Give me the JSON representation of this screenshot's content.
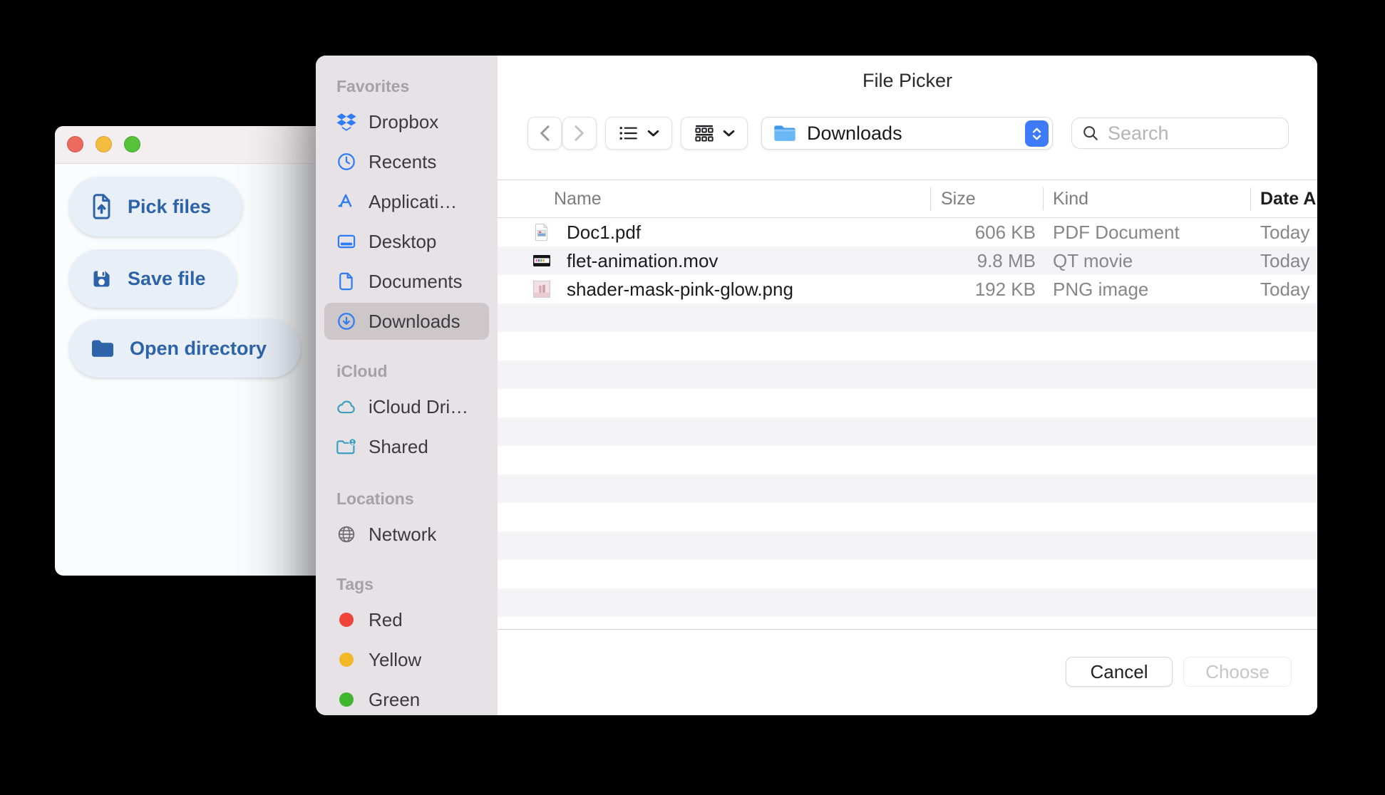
{
  "app_window": {
    "traffic_lights": [
      {
        "id": "close",
        "color": "#ed6a5e",
        "border": "#d65548"
      },
      {
        "id": "minimize",
        "color": "#f4bd3e",
        "border": "#d9a132"
      },
      {
        "id": "zoom",
        "color": "#57c33b",
        "border": "#47a52f"
      }
    ],
    "buttons": [
      {
        "id": "pick-files",
        "label": "Pick files",
        "icon": "document-upload-icon"
      },
      {
        "id": "save-file",
        "label": "Save file",
        "icon": "save-icon"
      },
      {
        "id": "open-directory",
        "label": "Open directory",
        "icon": "folder-icon"
      }
    ]
  },
  "dialog": {
    "title": "File Picker",
    "sidebar": {
      "sections": [
        {
          "header": "Favorites",
          "items": [
            {
              "label": "Dropbox",
              "icon": "dropbox-icon"
            },
            {
              "label": "Recents",
              "icon": "clock-icon"
            },
            {
              "label": "Applicati…",
              "icon": "appstore-icon"
            },
            {
              "label": "Desktop",
              "icon": "desktop-icon"
            },
            {
              "label": "Documents",
              "icon": "document-icon"
            },
            {
              "label": "Downloads",
              "icon": "download-circle-icon",
              "selected": true
            }
          ]
        },
        {
          "header": "iCloud",
          "items": [
            {
              "label": "iCloud Dri…",
              "icon": "cloud-icon"
            },
            {
              "label": "Shared",
              "icon": "shared-folder-icon"
            }
          ]
        },
        {
          "header": "Locations",
          "items": [
            {
              "label": "Network",
              "icon": "globe-icon"
            }
          ]
        },
        {
          "header": "Tags",
          "items": [
            {
              "label": "Red",
              "icon": "tag-dot-icon",
              "color": "#f0443a"
            },
            {
              "label": "Yellow",
              "icon": "tag-dot-icon",
              "color": "#f3b827"
            },
            {
              "label": "Green",
              "icon": "tag-dot-icon",
              "color": "#41b52e"
            }
          ]
        }
      ]
    },
    "toolbar": {
      "path_label": "Downloads",
      "search_placeholder": "Search"
    },
    "table": {
      "columns": [
        {
          "label": "Name",
          "sorted": false
        },
        {
          "label": "Size",
          "sorted": false
        },
        {
          "label": "Kind",
          "sorted": false
        },
        {
          "label": "Date Added",
          "sorted": true
        }
      ],
      "rows": [
        {
          "name": "Doc1.pdf",
          "icon": "pdf-file-icon",
          "size": "606 KB",
          "kind": "PDF Document",
          "date_added": "Today"
        },
        {
          "name": "flet-animation.mov",
          "icon": "mov-file-icon",
          "size": "9.8 MB",
          "kind": "QT movie",
          "date_added": "Today"
        },
        {
          "name": "shader-mask-pink-glow.png",
          "icon": "png-file-icon",
          "size": "192 KB",
          "kind": "PNG image",
          "date_added": "Today"
        }
      ],
      "empty_row_count": 12
    },
    "footer": {
      "cancel_label": "Cancel",
      "choose_label": "Choose",
      "choose_disabled": true
    }
  },
  "colors": {
    "accent_blue": "#3d7bf8",
    "sidebar_icon_blue": "#2e7cf6",
    "icloud_teal": "#3aa0c0",
    "app_button_blue": "#2d63a9"
  }
}
